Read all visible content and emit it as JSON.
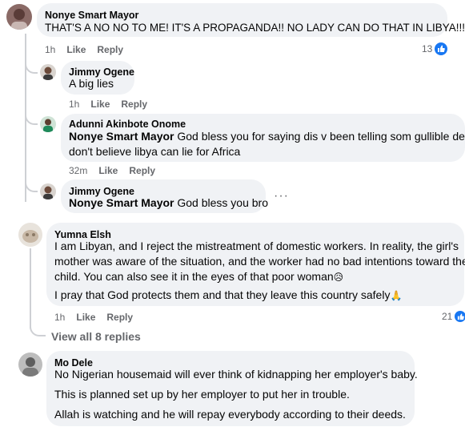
{
  "comments": [
    {
      "author": "Nonye Smart Mayor",
      "text": "THAT'S A NO NO TO ME! IT'S A PROPAGANDA!! NO LADY CAN DO THAT IN LIBYA!!!",
      "time": "1h",
      "like_label": "Like",
      "reply_label": "Reply",
      "reaction_count": "13",
      "reaction_icon": "like-icon"
    },
    {
      "author": "Jimmy Ogene",
      "text": "A big lies",
      "time": "1h",
      "like_label": "Like",
      "reply_label": "Reply"
    },
    {
      "author": "Adunni Akinbote Onome",
      "mention": "Nonye Smart Mayor",
      "text_line1": "God bless you for saying dis v been telling som gullible dey",
      "text_line2": "don't believe libya can lie for Africa",
      "time": "32m",
      "like_label": "Like",
      "reply_label": "Reply"
    },
    {
      "author": "Jimmy Ogene",
      "mention": "Nonye Smart Mayor",
      "text": "God bless you bro",
      "more_icon": "more-options-icon"
    },
    {
      "author": "Yumna Elsh",
      "para1_line1": "I am Libyan, and I reject the mistreatment of domestic workers. In reality, the girl's",
      "para1_line2": "mother was aware of the situation, and the worker had no bad intentions toward the",
      "para1_line3": "child. You can also see it in the eyes of that poor woman",
      "emoji1": "😥",
      "para2": "I pray that God protects them and that they leave this country safely",
      "emoji2": "🙏",
      "time": "1h",
      "like_label": "Like",
      "reply_label": "Reply",
      "reaction_count": "21"
    },
    {
      "author": "Mo Dele",
      "para1": "No Nigerian housemaid will ever think of kidnapping her employer's baby.",
      "para2": "This is planned set up by her employer to put her in trouble.",
      "para3": "Allah is watching and he will repay everybody according to their deeds."
    }
  ],
  "view_replies": "View all 8 replies",
  "colors": {
    "bubble": "#f0f2f5",
    "secondary_text": "#65676b",
    "like_blue": "#1877f2",
    "thread_line": "#ced0d4"
  }
}
